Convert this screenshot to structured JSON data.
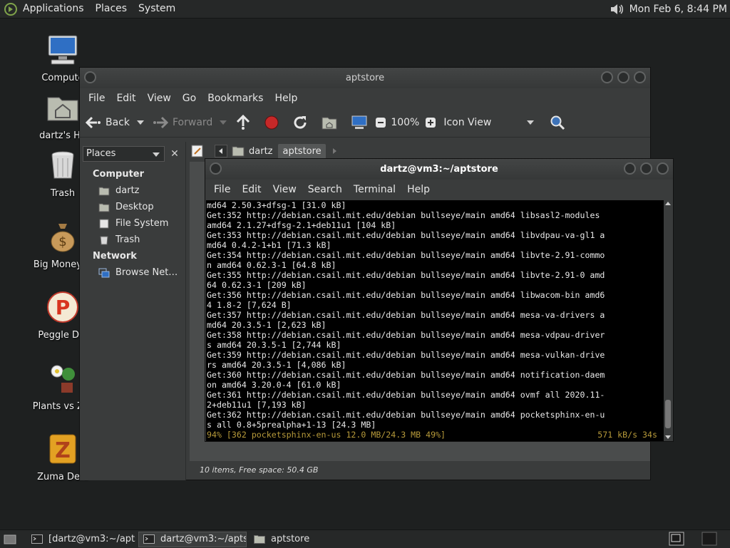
{
  "top_panel": {
    "menus": [
      "Applications",
      "Places",
      "System"
    ],
    "clock": "Mon Feb  6,  8:44 PM"
  },
  "desktop": {
    "icons": [
      {
        "label": "Compute",
        "icon": "computer-icon"
      },
      {
        "label": "dartz's Ho",
        "icon": "home-folder-icon"
      },
      {
        "label": "Trash",
        "icon": "trash-icon"
      },
      {
        "label": "Big Money D",
        "icon": "money-bag-icon"
      },
      {
        "label": "Peggle Del",
        "icon": "peggle-icon"
      },
      {
        "label": "Plants vs Zor",
        "icon": "plants-icon"
      },
      {
        "label": "Zuma Delu",
        "icon": "zuma-icon"
      }
    ]
  },
  "file_manager": {
    "title": "aptstore",
    "menus": [
      "File",
      "Edit",
      "View",
      "Go",
      "Bookmarks",
      "Help"
    ],
    "toolbar": {
      "back": "Back",
      "forward": "Forward",
      "zoom": "100%",
      "view_mode": "Icon View"
    },
    "sidebar": {
      "selector": "Places",
      "computer_heading": "Computer",
      "computer_items": [
        "dartz",
        "Desktop",
        "File System",
        "Trash"
      ],
      "network_heading": "Network",
      "network_items": [
        "Browse Net…"
      ]
    },
    "breadcrumb": [
      "dartz",
      "aptstore"
    ],
    "status": "10 items, Free space: 50.4 GB"
  },
  "terminal": {
    "title": "dartz@vm3:~/aptstore",
    "menus": [
      "File",
      "Edit",
      "View",
      "Search",
      "Terminal",
      "Help"
    ],
    "lines": [
      "md64 2.50.3+dfsg-1 [31.0 kB]",
      "Get:352 http://debian.csail.mit.edu/debian bullseye/main amd64 libsasl2-modules",
      "amd64 2.1.27+dfsg-2.1+deb11u1 [104 kB]",
      "Get:353 http://debian.csail.mit.edu/debian bullseye/main amd64 libvdpau-va-gl1 a",
      "md64 0.4.2-1+b1 [71.3 kB]",
      "Get:354 http://debian.csail.mit.edu/debian bullseye/main amd64 libvte-2.91-commo",
      "n amd64 0.62.3-1 [64.8 kB]",
      "Get:355 http://debian.csail.mit.edu/debian bullseye/main amd64 libvte-2.91-0 amd",
      "64 0.62.3-1 [209 kB]",
      "Get:356 http://debian.csail.mit.edu/debian bullseye/main amd64 libwacom-bin amd6",
      "4 1.8-2 [7,624 B]",
      "Get:357 http://debian.csail.mit.edu/debian bullseye/main amd64 mesa-va-drivers a",
      "md64 20.3.5-1 [2,623 kB]",
      "Get:358 http://debian.csail.mit.edu/debian bullseye/main amd64 mesa-vdpau-driver",
      "s amd64 20.3.5-1 [2,744 kB]",
      "Get:359 http://debian.csail.mit.edu/debian bullseye/main amd64 mesa-vulkan-drive",
      "rs amd64 20.3.5-1 [4,086 kB]",
      "Get:360 http://debian.csail.mit.edu/debian bullseye/main amd64 notification-daem",
      "on amd64 3.20.0-4 [61.0 kB]",
      "Get:361 http://debian.csail.mit.edu/debian bullseye/main amd64 ovmf all 2020.11-",
      "2+deb11u1 [7,193 kB]",
      "Get:362 http://debian.csail.mit.edu/debian bullseye/main amd64 pocketsphinx-en-u",
      "s all 0.8+5prealpha+1-13 [24.3 MB]"
    ],
    "progress_left": "94% [362 pocketsphinx-en-us 12.0 MB/24.3 MB 49%]",
    "progress_right": "571 kB/s 34s"
  },
  "taskbar": {
    "tasks": [
      "[dartz@vm3:~/apts…",
      "dartz@vm3:~/aptst…",
      "aptstore"
    ]
  },
  "colors": {
    "progress": "#b79a3a",
    "panel": "#262828",
    "desktop": "#1e2020"
  }
}
